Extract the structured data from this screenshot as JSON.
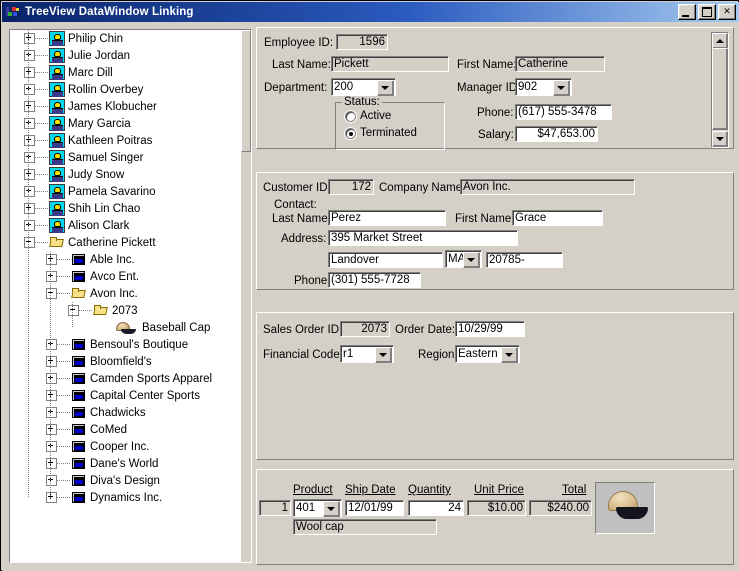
{
  "window": {
    "title": "TreeView DataWindow Linking",
    "icon": "app-icon",
    "controls": {
      "minimize": "_",
      "maximize": "□",
      "close": "X"
    }
  },
  "tree": {
    "items": [
      {
        "label": "Philip  Chin",
        "icon": "person-icon",
        "indent": 0,
        "toggle": "plus"
      },
      {
        "label": "Julie  Jordan",
        "icon": "person-icon",
        "indent": 0,
        "toggle": "plus"
      },
      {
        "label": "Marc  Dill",
        "icon": "person-icon",
        "indent": 0,
        "toggle": "plus"
      },
      {
        "label": "Rollin  Overbey",
        "icon": "person-icon",
        "indent": 0,
        "toggle": "plus"
      },
      {
        "label": "James  Klobucher",
        "icon": "person-icon",
        "indent": 0,
        "toggle": "plus"
      },
      {
        "label": "Mary  Garcia",
        "icon": "person-icon",
        "indent": 0,
        "toggle": "plus"
      },
      {
        "label": "Kathleen  Poitras",
        "icon": "person-icon",
        "indent": 0,
        "toggle": "plus"
      },
      {
        "label": "Samuel  Singer",
        "icon": "person-icon",
        "indent": 0,
        "toggle": "plus"
      },
      {
        "label": "Judy  Snow",
        "icon": "person-icon",
        "indent": 0,
        "toggle": "plus"
      },
      {
        "label": "Pamela  Savarino",
        "icon": "person-icon",
        "indent": 0,
        "toggle": "plus"
      },
      {
        "label": "Shih Lin  Chao",
        "icon": "person-icon",
        "indent": 0,
        "toggle": "plus"
      },
      {
        "label": "Alison  Clark",
        "icon": "person-icon",
        "indent": 0,
        "toggle": "plus"
      },
      {
        "label": "Catherine  Pickett",
        "icon": "folder-open-icon",
        "indent": 0,
        "toggle": "minus"
      },
      {
        "label": "Able Inc.",
        "icon": "company-icon",
        "indent": 1,
        "toggle": "plus"
      },
      {
        "label": "Avco Ent.",
        "icon": "company-icon",
        "indent": 1,
        "toggle": "plus"
      },
      {
        "label": "Avon Inc.",
        "icon": "folder-open-icon",
        "indent": 1,
        "toggle": "minus"
      },
      {
        "label": "2073",
        "icon": "folder-open-icon",
        "indent": 2,
        "toggle": "minus"
      },
      {
        "label": "Baseball Cap",
        "icon": "cap-icon",
        "indent": 3,
        "toggle": "none"
      },
      {
        "label": "Bensoul's Boutique",
        "icon": "company-icon",
        "indent": 1,
        "toggle": "plus"
      },
      {
        "label": "Bloomfield's",
        "icon": "company-icon",
        "indent": 1,
        "toggle": "plus"
      },
      {
        "label": "Camden Sports Apparel",
        "icon": "company-icon",
        "indent": 1,
        "toggle": "plus"
      },
      {
        "label": "Capital Center Sports",
        "icon": "company-icon",
        "indent": 1,
        "toggle": "plus"
      },
      {
        "label": "Chadwicks",
        "icon": "company-icon",
        "indent": 1,
        "toggle": "plus"
      },
      {
        "label": "CoMed",
        "icon": "company-icon",
        "indent": 1,
        "toggle": "plus"
      },
      {
        "label": "Cooper Inc.",
        "icon": "company-icon",
        "indent": 1,
        "toggle": "plus"
      },
      {
        "label": "Dane's World",
        "icon": "company-icon",
        "indent": 1,
        "toggle": "plus"
      },
      {
        "label": "Diva's Design",
        "icon": "company-icon",
        "indent": 1,
        "toggle": "plus"
      },
      {
        "label": "Dynamics Inc.",
        "icon": "company-icon",
        "indent": 1,
        "toggle": "plus"
      }
    ]
  },
  "employee": {
    "id_label": "Employee ID:",
    "id_value": "1596",
    "last_name_label": "Last Name:",
    "last_name_value": "Pickett",
    "first_name_label": "First Name:",
    "first_name_value": "Catherine",
    "department_label": "Department:",
    "department_value": "200",
    "manager_label": "Manager ID:",
    "manager_value": "902",
    "status_group_label": "Status:",
    "status_active_label": "Active",
    "status_terminated_label": "Terminated",
    "status_selected": "Terminated",
    "phone_label": "Phone:",
    "phone_value": "(617) 555-3478",
    "salary_label": "Salary:",
    "salary_value": "$47,653.00"
  },
  "customer": {
    "id_label": "Customer ID:",
    "id_value": "172",
    "company_label": "Company Name:",
    "company_value": "Avon Inc.",
    "contact_label": "Contact:",
    "last_name_label": "Last Name:",
    "last_name_value": "Perez",
    "first_name_label": "First Name:",
    "first_name_value": "Grace",
    "address_label": "Address:",
    "address_value": "395 Market Street",
    "city_value": "Landover",
    "state_value": "MA",
    "zip_value": "20785-",
    "phone_label": "Phone:",
    "phone_value": "(301) 555-7728"
  },
  "order": {
    "id_label": "Sales Order ID:",
    "id_value": "2073",
    "date_label": "Order Date:",
    "date_value": "10/29/99",
    "fin_label": "Financial Code:",
    "fin_value": "r1",
    "region_label": "Region:",
    "region_value": "Eastern"
  },
  "lineitems": {
    "headers": [
      "Product",
      "Ship Date",
      "Quantity",
      "Unit Price",
      "Total"
    ],
    "row": {
      "num": "1",
      "product": "401",
      "ship_date": "12/01/99",
      "quantity": "24",
      "unit_price": "$10.00",
      "total": "$240.00",
      "description": "Wool cap",
      "image": "baseball-cap-image"
    }
  }
}
